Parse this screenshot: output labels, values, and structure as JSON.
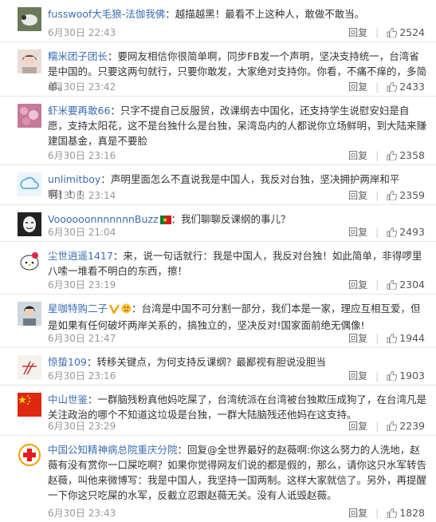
{
  "actions": {
    "reply_label": "回复",
    "separator": "|"
  },
  "comments": [
    {
      "user": "fusswoof大毛狼-法伽我佛",
      "text": "：越描越黑！最看不上这种人，敢做不敢当。",
      "time": "6月30日 22:43",
      "likes": "2524",
      "avatar": "sheep-avatar"
    },
    {
      "user": "糯米团子团长",
      "text": "：要网友相信你很简单啊，同步FB发一个声明，坚决支持统一，台湾省是中国的。只要这两句就行，只要你敢发，大家绝对支持你。你看，不痛不痒的，多简单。",
      "time": "6月30日 23:42",
      "likes": "2433",
      "avatar": "girl-avatar"
    },
    {
      "user": "虾米要再敢66",
      "text": "：只字不提自己反服贸，改课纲去中国化，还支持学生说慰安妇是自愿，支持太阳花，这不是台独什么是台独，呆湾岛内的人都说你立场鲜明，到大陆来赚建国基金，真是不要脸",
      "time": "6月30日 23:16",
      "likes": "2358",
      "avatar": "flowers-avatar"
    },
    {
      "user": "unlimitboy",
      "text": "：声明里面怎么不直说我是中国人，我反对台独，坚决拥护两岸和平啊！！！",
      "time": "6月30日 23:14",
      "likes": "2359",
      "avatar": "default-avatar"
    },
    {
      "user": "VoooooonnnnnnnBuzz",
      "text": "：我们聊聊反课纲的事儿？",
      "time": "6月30日 21:04",
      "likes": "2493",
      "avatar": "mask-avatar"
    },
    {
      "user": "尘世逍遥1417",
      "text": "：来，说一句话就行：我是中国人，我反对台独！如此简单，非得啰里八嗦一堆看不明白的东西，擦！",
      "time": "6月30日 23:19",
      "likes": "2304",
      "avatar": "kitty-avatar"
    },
    {
      "user": "星咖特购二子",
      "text": "：台湾是中国不可分割一部分，我们本是一家，理应互相互爱，但是如果有任何破坏两岸关系的，搞独立的，坚决反对!国家面前绝无偶像!",
      "time": "6月30日 21:47",
      "likes": "1944",
      "avatar": "woman-avatar",
      "badges": [
        "V",
        "face"
      ]
    },
    {
      "user": "惊蛰109",
      "text": "：转移关键点，为何支持反课纲？最鄙视有胆说没胆当",
      "time": "6月30日 23:16",
      "likes": "1903",
      "avatar": "sketch-avatar"
    },
    {
      "user": "中山世鉴",
      "text": "：一群脑残粉真他妈吃屎了，台湾统派在台湾被台独欺压成狗了，在台湾凡是关注政治的哪个不知道这垃圾是台独，一群大陆脑残还他妈在这支持。",
      "time": "6月30日 23:29",
      "likes": "2239",
      "avatar": "flag-avatar"
    },
    {
      "user": "中国公知精神病总院重庆分院",
      "text": "：回复@全世界最好的赵薇啊:你这么努力的人洗地，赵薇有没有赏你一口屎吃啊？如果你觉得网友们说的都是假的，那么，请你这只水军转告赵薇，叫他来微博写：我是中国人，我坚持一国两制。这样大家就信了。另外，再提醒一下你这只吃屎的水军，反截立忍跟赵薇无关。没有人诋毁赵薇。",
      "time": "6月30日 23:43",
      "likes": "1828",
      "avatar": "redcross-avatar"
    }
  ]
}
